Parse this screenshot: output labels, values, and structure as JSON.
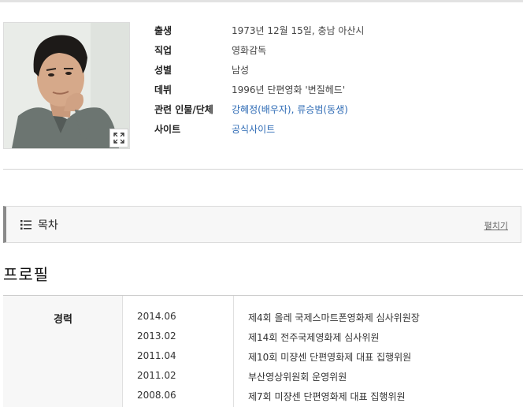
{
  "profile": {
    "photo_alt": "",
    "rows": [
      {
        "label": "출생",
        "value": "1973년 12월 15일, 충남 아산시"
      },
      {
        "label": "직업",
        "value": "영화감독"
      },
      {
        "label": "성별",
        "value": "남성"
      },
      {
        "label": "데뷔",
        "value": "1996년 단편영화 '변질헤드'"
      },
      {
        "label": "관련 인물/단체",
        "links": [
          "강혜정(배우자)",
          "류승범(동생)"
        ],
        "link_separator": ", "
      },
      {
        "label": "사이트",
        "links": [
          "공식사이트"
        ]
      }
    ]
  },
  "toc": {
    "title": "목차",
    "toggle_label": "펼치기"
  },
  "profile_section": {
    "title": "프로필",
    "career_label": "경력",
    "career": [
      {
        "date": "2014.06",
        "desc": "제4회 올레 국제스마트폰영화제 심사위원장"
      },
      {
        "date": "2013.02",
        "desc": "제14회 전주국제영화제 심사위원"
      },
      {
        "date": "2011.04",
        "desc": "제10회 미쟝센 단편영화제 대표 집행위원"
      },
      {
        "date": "2011.02",
        "desc": "부산영상위원회 운영위원"
      },
      {
        "date": "2008.06",
        "desc": "제7회 미쟝센 단편영화제 대표 집행위원"
      }
    ]
  },
  "colors": {
    "link": "#2e6bb5",
    "toc_accent": "#8a8a8a"
  }
}
